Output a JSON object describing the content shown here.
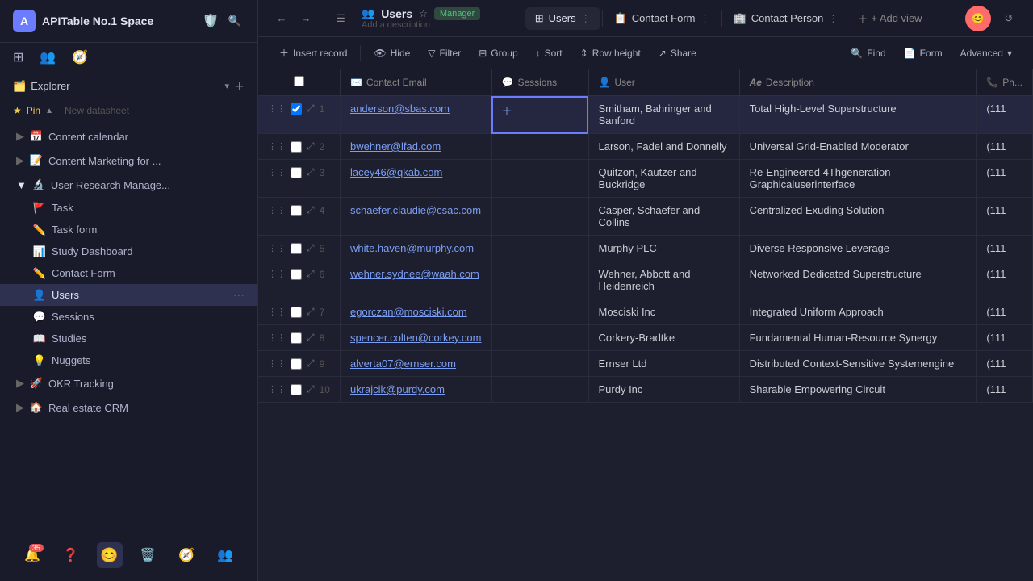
{
  "app": {
    "title": "APITable No.1 Space",
    "workspace_icon": "🛡️",
    "user_initial": "A"
  },
  "sidebar": {
    "explorer_label": "Explorer",
    "new_datasheet": "New datasheet",
    "pin_label": "Pin",
    "items": [
      {
        "id": "content-calendar",
        "icon": "📅",
        "label": "Content calendar",
        "has_add": true
      },
      {
        "id": "content-marketing",
        "icon": "📝",
        "label": "Content Marketing for ...",
        "has_add": true
      },
      {
        "id": "user-research",
        "icon": "🔬",
        "label": "User Research Manage...",
        "has_add": true,
        "expanded": true
      },
      {
        "id": "okr-tracking",
        "icon": "🚀",
        "label": "OKR Tracking",
        "has_add": true
      },
      {
        "id": "real-estate",
        "icon": "🏠",
        "label": "Real estate CRM",
        "has_add": true
      }
    ],
    "subitems": [
      {
        "id": "task",
        "icon": "🚩",
        "label": "Task"
      },
      {
        "id": "task-form",
        "icon": "✏️",
        "label": "Task form"
      },
      {
        "id": "study-dashboard",
        "icon": "📊",
        "label": "Study Dashboard"
      },
      {
        "id": "contact-form",
        "icon": "✏️",
        "label": "Contact Form"
      },
      {
        "id": "users",
        "icon": "👤",
        "label": "Users",
        "active": true
      },
      {
        "id": "sessions",
        "icon": "💬",
        "label": "Sessions"
      },
      {
        "id": "studies",
        "icon": "📖",
        "label": "Studies"
      },
      {
        "id": "nuggets",
        "icon": "💡",
        "label": "Nuggets"
      }
    ],
    "bottom_icons": {
      "notification_count": "35"
    }
  },
  "topbar": {
    "workspace": "Users",
    "manager_badge": "Manager",
    "description": "Add a description",
    "views": [
      {
        "id": "users",
        "icon": "👥",
        "label": "Users",
        "active": true
      },
      {
        "id": "contact-form",
        "icon": "📋",
        "label": "Contact Form"
      },
      {
        "id": "contact-person",
        "icon": "🏢",
        "label": "Contact Person"
      }
    ],
    "add_view": "+ Add view",
    "find_label": "Find",
    "form_label": "Form",
    "advanced_label": "Advanced"
  },
  "toolbar": {
    "insert_record": "Insert record",
    "hide": "Hide",
    "filter": "Filter",
    "group": "Group",
    "sort": "Sort",
    "row_height": "Row height",
    "share": "Share"
  },
  "table": {
    "columns": [
      {
        "id": "contact-email",
        "icon": "✉️",
        "label": "Contact Email"
      },
      {
        "id": "sessions",
        "icon": "💬",
        "label": "Sessions"
      },
      {
        "id": "user",
        "icon": "👤",
        "label": "User"
      },
      {
        "id": "description",
        "icon": "Ae",
        "label": "Description"
      },
      {
        "id": "phone",
        "icon": "📞",
        "label": "Ph..."
      }
    ],
    "rows": [
      {
        "num": "1",
        "email": "anderson@sbas.com",
        "sessions": "",
        "user": "Smitham, Bahringer and Sanford",
        "description": "Total High-Level Superstructure",
        "phone": "(111"
      },
      {
        "num": "2",
        "email": "bwehner@lfad.com",
        "sessions": "",
        "user": "Larson, Fadel and Donnelly",
        "description": "Universal Grid-Enabled Moderator",
        "phone": "(111"
      },
      {
        "num": "3",
        "email": "lacey46@qkab.com",
        "sessions": "",
        "user": "Quitzon, Kautzer and Buckridge",
        "description": "Re-Engineered 4Thgeneration Graphicaluserinterface",
        "phone": "(111"
      },
      {
        "num": "4",
        "email": "schaefer.claudie@csac.com",
        "sessions": "",
        "user": "Casper, Schaefer and Collins",
        "description": "Centralized Exuding Solution",
        "phone": "(111"
      },
      {
        "num": "5",
        "email": "white.haven@murphy.com",
        "sessions": "",
        "user": "Murphy PLC",
        "description": "Diverse Responsive Leverage",
        "phone": "(111"
      },
      {
        "num": "6",
        "email": "wehner.sydnee@waah.com",
        "sessions": "",
        "user": "Wehner, Abbott and Heidenreich",
        "description": "Networked Dedicated Superstructure",
        "phone": "(111"
      },
      {
        "num": "7",
        "email": "egorczan@mosciski.com",
        "sessions": "",
        "user": "Mosciski Inc",
        "description": "Integrated Uniform Approach",
        "phone": "(111"
      },
      {
        "num": "8",
        "email": "spencer.colten@corkey.com",
        "sessions": "",
        "user": "Corkery-Bradtke",
        "description": "Fundamental Human-Resource Synergy",
        "phone": "(111"
      },
      {
        "num": "9",
        "email": "alverta07@ernser.com",
        "sessions": "",
        "user": "Ernser Ltd",
        "description": "Distributed Context-Sensitive Systemengine",
        "phone": "(111"
      },
      {
        "num": "10",
        "email": "ukrajcik@purdy.com",
        "sessions": "",
        "user": "Purdy Inc",
        "description": "Sharable Empowering Circuit",
        "phone": "(111"
      }
    ]
  }
}
